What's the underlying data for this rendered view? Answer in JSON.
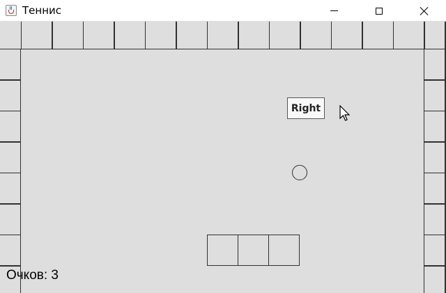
{
  "window": {
    "title": "Теннис"
  },
  "controls": {
    "minimize_icon": "minimize-icon",
    "maximize_icon": "maximize-icon",
    "close_icon": "close-icon"
  },
  "game": {
    "key_indicator": "Right",
    "score_text": "Очков: 3",
    "colors": {
      "background": "#dedede",
      "lines": "#303030",
      "titlebar": "#ffffff"
    }
  }
}
